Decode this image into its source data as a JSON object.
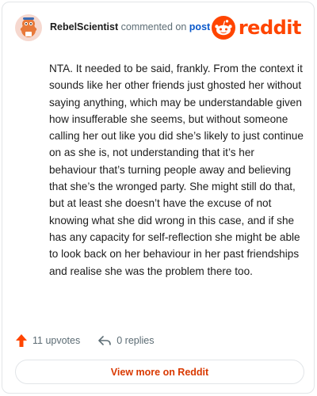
{
  "comment": {
    "author": "RebelScientist",
    "verb": "commented on",
    "target": "post",
    "text": "NTA. It needed to be said, frankly. From the context it sounds like her other friends just ghosted her without saying anything, which may be understandable given how insufferable she seems, but without someone calling her out like you did she’s likely to just continue on as she is, not understanding that it’s her behaviour that’s turning people away and believing that she’s the wronged party. She might still do that, but at least she doesn’t have the excuse of not knowing what she did wrong in this case, and if she has any capacity for self-reflection she might be able to look back on her behaviour in her past friendships and realise she was the problem there too."
  },
  "brand": {
    "name": "reddit",
    "icon": "reddit-snoo-icon",
    "color": "#ff4500"
  },
  "actions": {
    "upvotes": "11 upvotes",
    "replies": "0 replies"
  },
  "footer": {
    "view_more": "View more on Reddit"
  },
  "colors": {
    "accent": "#ff4500",
    "link": "#0a58ca",
    "button_text": "#d93900",
    "muted": "#5c6c74"
  }
}
